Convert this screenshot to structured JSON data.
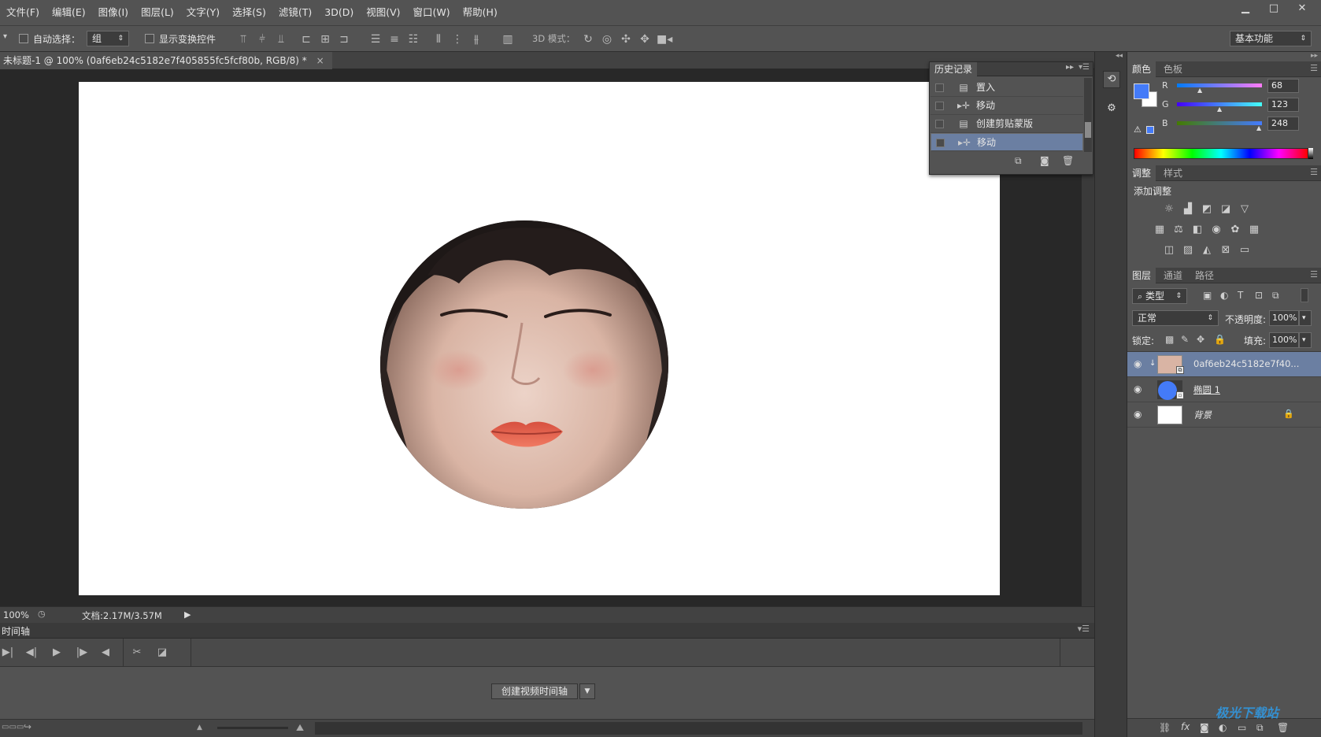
{
  "menu": [
    "文件(F)",
    "编辑(E)",
    "图像(I)",
    "图层(L)",
    "文字(Y)",
    "选择(S)",
    "滤镜(T)",
    "3D(D)",
    "视图(V)",
    "窗口(W)",
    "帮助(H)"
  ],
  "window_controls": {
    "minimize": "▁",
    "maximize": "□",
    "close": "✕"
  },
  "options": {
    "auto_select_label": "自动选择：",
    "auto_select_value": "组",
    "show_transform_label": "显示变换控件",
    "mode3d_label": "3D 模式：",
    "workspace": "基本功能"
  },
  "document_tab": {
    "title": "未标题-1 @ 100% (0af6eb24c5182e7f405855fc5fcf80b, RGB/8) *",
    "close": "×"
  },
  "status": {
    "zoom": "100%",
    "doc": "文档:2.17M/3.57M"
  },
  "timeline": {
    "title": "时间轴",
    "create_button": "创建视频时间轴"
  },
  "history": {
    "title": "历史记录",
    "items": [
      {
        "label": "置入",
        "icon": "document-icon"
      },
      {
        "label": "移动",
        "icon": "move-icon"
      },
      {
        "label": "创建剪贴蒙版",
        "icon": "document-icon"
      },
      {
        "label": "移动",
        "icon": "move-icon",
        "selected": true
      }
    ]
  },
  "color_panel": {
    "tabs": [
      "颜色",
      "色板"
    ],
    "r_label": "R",
    "g_label": "G",
    "b_label": "B",
    "r": "68",
    "g": "123",
    "b": "248",
    "foreground": "#447bf8"
  },
  "adjust_panel": {
    "tabs": [
      "调整",
      "样式"
    ],
    "add_label": "添加调整"
  },
  "layers_panel": {
    "tabs": [
      "图层",
      "通道",
      "路径"
    ],
    "filter": "类型",
    "blend": "正常",
    "opacity_label": "不透明度:",
    "opacity": "100%",
    "lock_label": "锁定:",
    "fill_label": "填充:",
    "fill": "100%",
    "layers": [
      {
        "name": "0af6eb24c5182e7f40...",
        "selected": true
      },
      {
        "name": "椭圆 1"
      },
      {
        "name": "背景"
      }
    ]
  },
  "watermark": "极光下载站"
}
